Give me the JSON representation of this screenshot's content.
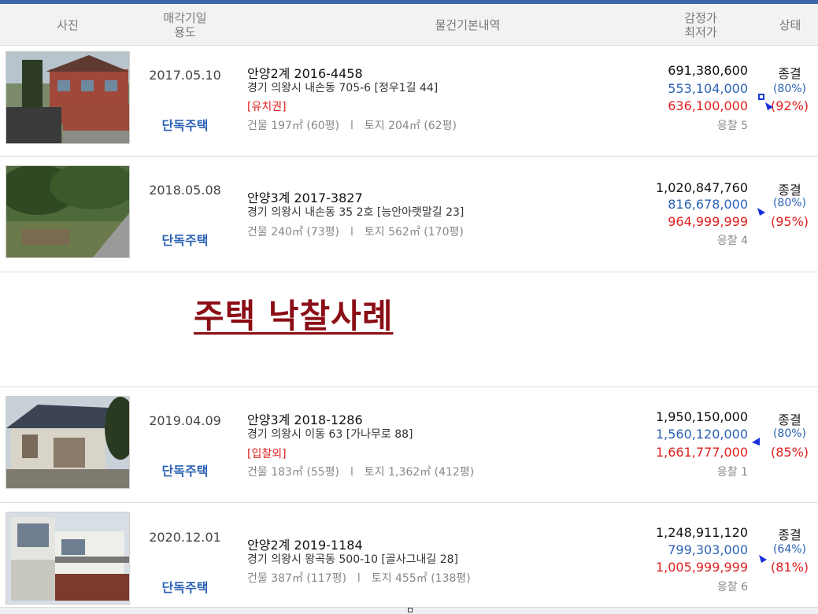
{
  "header": {
    "photo": "사진",
    "date_line1": "매각기일",
    "date_line2": "용도",
    "info": "물건기본내역",
    "price_line1": "감정가",
    "price_line2": "최저가",
    "status": "상태"
  },
  "banner": {
    "title": "주택  낙찰사례"
  },
  "rows": [
    {
      "date": "2017.05.10",
      "usage": "단독주택",
      "case": "안양2계 2016-4458",
      "address": "경기 의왕시 내손동 705-6 [정우1길 44]",
      "tag": "[유치권]",
      "building": "건물 197㎡ (60평)",
      "separator": "l",
      "land": "토지 204㎡ (62평)",
      "appraisal": "691,380,600",
      "min_price": "553,104,000",
      "sale_price": "636,100,000",
      "bidders": "응찰 5",
      "status": "종결",
      "min_pct": "(80%)",
      "sale_pct": "(92%)"
    },
    {
      "date": "2018.05.08",
      "usage": "단독주택",
      "case": "안양3계 2017-3827",
      "address": "경기 의왕시 내손동 35 2호 [능안아랫말길 23]",
      "tag": "",
      "building": "건물 240㎡ (73평)",
      "separator": "l",
      "land": "토지 562㎡ (170평)",
      "appraisal": "1,020,847,760",
      "min_price": "816,678,000",
      "sale_price": "964,999,999",
      "bidders": "응찰 4",
      "status": "종결",
      "min_pct": "(80%)",
      "sale_pct": "(95%)"
    },
    {
      "date": "2019.04.09",
      "usage": "단독주택",
      "case": "안양3계 2018-1286",
      "address": "경기 의왕시 이동 63 [가나무로 88]",
      "tag": "[입찰외]",
      "building": "건물 183㎡ (55평)",
      "separator": "l",
      "land": "토지 1,362㎡ (412평)",
      "appraisal": "1,950,150,000",
      "min_price": "1,560,120,000",
      "sale_price": "1,661,777,000",
      "bidders": "응찰 1",
      "status": "종결",
      "min_pct": "(80%)",
      "sale_pct": "(85%)"
    },
    {
      "date": "2020.12.01",
      "usage": "단독주택",
      "case": "안양2계 2019-1184",
      "address": "경기 의왕시 왕곡동 500-10 [골사그내길 28]",
      "tag": "",
      "building": "건물 387㎡ (117평)",
      "separator": "l",
      "land": "토지 455㎡ (138평)",
      "appraisal": "1,248,911,120",
      "min_price": "799,303,000",
      "sale_price": "1,005,999,999",
      "bidders": "응찰 6",
      "status": "종결",
      "min_pct": "(64%)",
      "sale_pct": "(81%)"
    }
  ],
  "colors": {
    "accent_bar": "#3b67a6",
    "usage_blue": "#2b62b4",
    "sale_red": "#e02020",
    "banner_maroon": "#8b0e16"
  },
  "icons": [
    "house-photo",
    "blue-arrow-icon"
  ]
}
